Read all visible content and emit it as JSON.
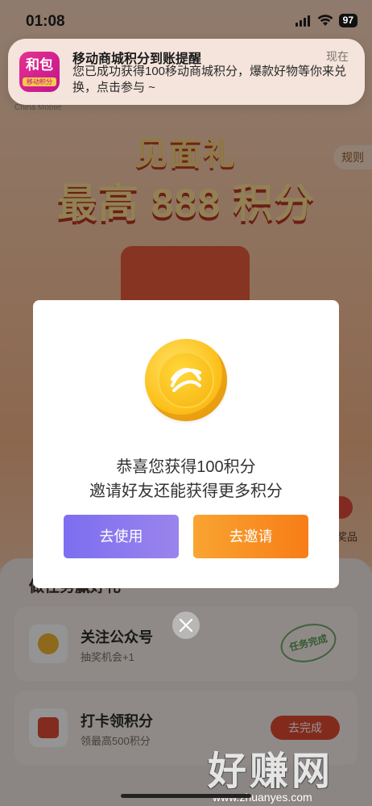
{
  "status_bar": {
    "time": "01:08",
    "battery": "97"
  },
  "notification": {
    "app_icon_main": "和包",
    "app_icon_sub": "移动积分",
    "title": "移动商城积分到账提醒",
    "time": "现在",
    "body": "您已成功获得100移动商城积分，爆款好物等你来兑换，点击参与 ~"
  },
  "background_page": {
    "brand": "China Mobile",
    "rules_tab": "规则",
    "hero_title": "见面礼",
    "hero_amount": "最高 888 积分",
    "prize_label": "奖品",
    "section_heading": "做任务赢好礼",
    "tasks": [
      {
        "title": "关注公众号",
        "subtitle": "抽奖机会+1",
        "status": "任务完成"
      },
      {
        "title": "打卡领积分",
        "subtitle": "领最高500积分",
        "action": "去完成"
      }
    ]
  },
  "modal": {
    "line1": "恭喜您获得100积分",
    "line2": "邀请好友还能获得更多积分",
    "use_button": "去使用",
    "invite_button": "去邀请"
  },
  "watermark": {
    "main": "好赚网",
    "sub": "www.zhuanyes.com"
  },
  "colors": {
    "use_button": "#7d6ef0",
    "invite_button": "#f88a1f",
    "coin": "#fdc21d"
  }
}
